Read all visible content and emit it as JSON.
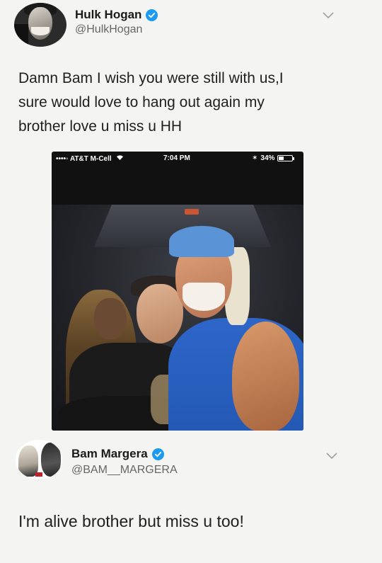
{
  "tweet1": {
    "display_name": "Hulk Hogan",
    "handle": "@HulkHogan",
    "verified": true,
    "text_lines": [
      "Damn Bam I wish you were still with us,I",
      "sure would love to hang out again my",
      "brother love u miss u HH"
    ],
    "embedded_screenshot": {
      "status_bar": {
        "carrier": "••••◦ AT&T M-Cell",
        "time": "7:04 PM",
        "battery": "34%",
        "battery_level": 0.34
      }
    }
  },
  "tweet2": {
    "display_name": "Bam Margera",
    "handle": "@BAM__MARGERA",
    "verified": true,
    "text": "I'm alive brother but miss u too!"
  },
  "icons": {
    "verified": "verified-badge-icon",
    "more": "chevron-down-icon",
    "wifi": "wifi-icon",
    "battery": "battery-icon"
  },
  "colors": {
    "verified_blue": "#1d9bf0",
    "background": "#f4f4f2",
    "text": "#1f1f1f",
    "handle_gray": "#666666"
  }
}
